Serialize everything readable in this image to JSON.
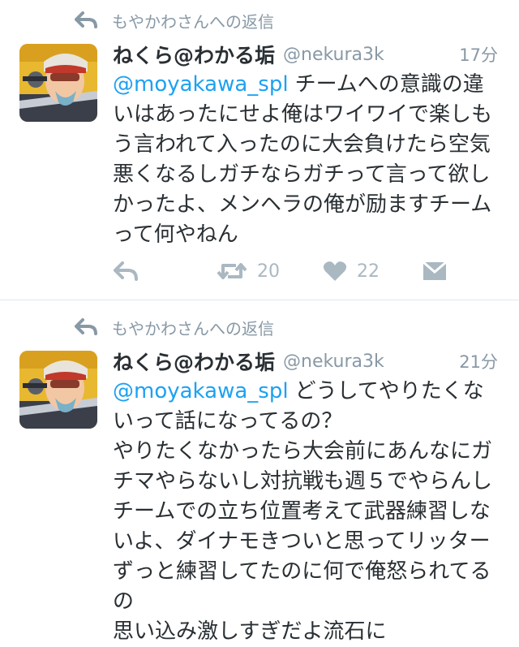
{
  "tweets": [
    {
      "reply_context": "もやかわさんへの返信",
      "display_name": "ねくら@わかる垢",
      "screen_name": "@nekura3k",
      "timestamp": "17分",
      "mention": "@moyakawa_spl",
      "text": "チームへの意識の違いはあったにせよ俺はワイワイで楽しもう言われて入ったのに大会負けたら空気悪くなるしガチならガチって言って欲しかったよ、メンヘラの俺が励ますチームって何やねん",
      "retweet_count": "20",
      "like_count": "22"
    },
    {
      "reply_context": "もやかわさんへの返信",
      "display_name": "ねくら@わかる垢",
      "screen_name": "@nekura3k",
      "timestamp": "21分",
      "mention": "@moyakawa_spl",
      "text": "どうしてやりたくないって話になってるの？\nやりたくなかったら大会前にあんなにガチマやらないし対抗戦も週５でやらんしチームでの立ち位置考えて武器練習しないよ、ダイナモきついと思ってリッターずっと練習してたのに何で俺怒られてるの\n思い込み激しすぎだよ流石に"
    }
  ],
  "colors": {
    "mention": "#1da1f2",
    "meta": "#8899a6",
    "action": "#aab8c2",
    "divider": "#e1e8ed"
  },
  "icons": {
    "reply_context": "reply-arrow-icon",
    "reply": "reply-icon",
    "retweet": "retweet-icon",
    "like": "heart-icon",
    "dm": "envelope-icon"
  }
}
